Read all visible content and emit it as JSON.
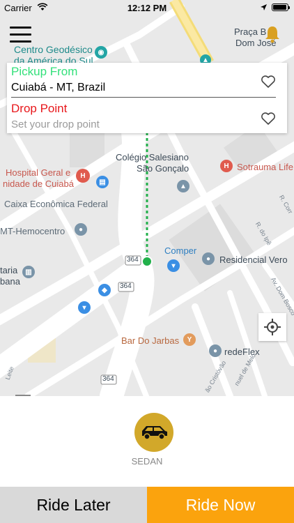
{
  "status_bar": {
    "carrier": "Carrier",
    "time": "12:12 PM"
  },
  "map": {
    "labels": {
      "centro_line1": "Centro Geodésico",
      "centro_line2": "da América do Sul",
      "praca_line1": "Praça B",
      "praca_line2": "Dom José",
      "colegio_line1": "Colégio Salesiano",
      "colegio_line2": "São Gonçalo",
      "hospital_line1": "Hospital Geral e",
      "hospital_line2": "nidade de Cuiabá",
      "sotrauma": "Sotrauma Life",
      "caixa": "Caixa Econômica Federal",
      "hemocentro": "MT-Hemocentro",
      "comper": "Comper",
      "residencial": "Residencial Vero",
      "taria_line1": "taria",
      "taria_line2": "bana",
      "bar": "Bar Do Jarbas",
      "redeflex": "redeFlex",
      "road_364": "364",
      "street_rcorr": "R. Corr",
      "street_rdoipe": "R. do Ipê",
      "street_avdombosco": "Av. Dom Bosco",
      "street_cristovao": "ão Cristóvão",
      "street_melo": "nuel de Melo",
      "street_leite": "Leite",
      "icon_h": "H"
    }
  },
  "search": {
    "pickup_label": "Pickup From",
    "pickup_value": "Cuiabá - MT, Brazil",
    "drop_label": "Drop Point",
    "drop_placeholder": "Set your drop point"
  },
  "vehicle": {
    "label": "SEDAN"
  },
  "actions": {
    "ride_later": "Ride Later",
    "ride_now": "Ride Now"
  },
  "colors": {
    "pickup": "#33e07a",
    "drop": "#e8171b",
    "ride_now": "#fba30d",
    "ride_later": "#d9d9d9",
    "vehicle_badge": "#d2a82a",
    "route": "#22b04b"
  }
}
